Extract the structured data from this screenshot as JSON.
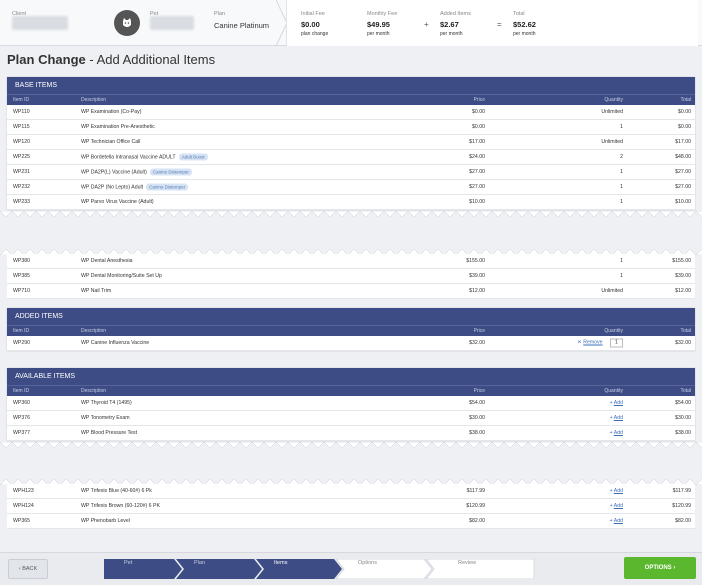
{
  "header": {
    "client_label": "Client",
    "pet_label": "Pet",
    "plan_label": "Plan",
    "plan_value": "Canine Platinum",
    "fees": [
      {
        "label": "Initial Fee",
        "value": "$0.00",
        "sub": "plan change"
      },
      {
        "label": "Monthly Fee",
        "value": "$49.95",
        "sub": "per month"
      },
      {
        "label": "Added Items",
        "value": "$2.67",
        "sub": "per month"
      },
      {
        "label": "Total",
        "value": "$52.62",
        "sub": "per month"
      }
    ],
    "operators": [
      "+",
      "="
    ]
  },
  "page_title": {
    "bold": "Plan Change",
    "rest": " - Add Additional Items"
  },
  "columns": {
    "id": "Item ID",
    "desc": "Description",
    "price": "Price",
    "qty": "Quantity",
    "total": "Total"
  },
  "base_items": {
    "title": "BASE ITEMS",
    "rows_top": [
      {
        "id": "WP110",
        "desc": "WP Examination (Co-Pay)",
        "tag": "",
        "price": "$0.00",
        "qty": "Unlimited",
        "total": "$0.00"
      },
      {
        "id": "WP115",
        "desc": "WP Examination Pre-Anesthetic",
        "tag": "",
        "price": "$0.00",
        "qty": "1",
        "total": "$0.00"
      },
      {
        "id": "WP120",
        "desc": "WP Technician Office Call",
        "tag": "",
        "price": "$17.00",
        "qty": "Unlimited",
        "total": "$17.00"
      },
      {
        "id": "WP225",
        "desc": "WP Bordetella Intranasal Vaccine ADULT",
        "tag": "Adult Boost",
        "price": "$24.00",
        "qty": "2",
        "total": "$48.00"
      },
      {
        "id": "WP231",
        "desc": "WP DA2P(L) Vaccine (Adult)",
        "tag": "Canine Distemper",
        "price": "$27.00",
        "qty": "1",
        "total": "$27.00"
      },
      {
        "id": "WP232",
        "desc": "WP DA2P (No Lepto) Adult",
        "tag": "Canine Distemper",
        "price": "$27.00",
        "qty": "1",
        "total": "$27.00"
      },
      {
        "id": "WP233",
        "desc": "WP Parvo Virus Vaccine (Adult)",
        "tag": "",
        "price": "$10.00",
        "qty": "1",
        "total": "$10.00"
      }
    ],
    "rows_bottom": [
      {
        "id": "WP380",
        "desc": "WP Dental Anesthesia",
        "price": "$155.00",
        "qty": "1",
        "total": "$155.00"
      },
      {
        "id": "WP385",
        "desc": "WP Dental Monitoring/Suite Set Up",
        "price": "$39.00",
        "qty": "1",
        "total": "$39.00"
      },
      {
        "id": "WP710",
        "desc": "WP Nail Trim",
        "price": "$12.00",
        "qty": "Unlimited",
        "total": "$12.00"
      }
    ]
  },
  "added_items": {
    "title": "ADDED ITEMS",
    "rows": [
      {
        "id": "WP290",
        "desc": "WP Canine Influenza Vaccine",
        "price": "$32.00",
        "remove_label": "Remove",
        "qty": "1",
        "total": "$32.00"
      }
    ]
  },
  "available_items": {
    "title": "AVAILABLE ITEMS",
    "add_label": "Add",
    "rows_top": [
      {
        "id": "WP360",
        "desc": "WP Thyroid T4 (1495)",
        "price": "$54.00",
        "total": "$54.00"
      },
      {
        "id": "WP376",
        "desc": "WP Tonometry Exam",
        "price": "$30.00",
        "total": "$30.00"
      },
      {
        "id": "WP377",
        "desc": "WP Blood Pressure Test",
        "price": "$38.00",
        "total": "$38.00"
      }
    ],
    "rows_bottom": [
      {
        "id": "WPH123",
        "desc": "WP Trifexis Blue (40-60#) 6 Pk",
        "price": "$117.99",
        "total": "$117.99"
      },
      {
        "id": "WPH124",
        "desc": "WP Trifexis Brown (60-120#) 6 PK",
        "price": "$120.99",
        "total": "$120.99"
      },
      {
        "id": "WP365",
        "desc": "WP Phenobarb Level",
        "price": "$82.00",
        "total": "$82.00"
      }
    ]
  },
  "footer": {
    "back_label": "BACK",
    "options_label": "OPTIONS",
    "steps": [
      "Pet",
      "Plan",
      "Items",
      "Options",
      "Review"
    ],
    "active_step": "Items"
  },
  "colors": {
    "section_header": "#3d4c84",
    "options_button": "#5bb82e",
    "link": "#3d6fb8"
  }
}
